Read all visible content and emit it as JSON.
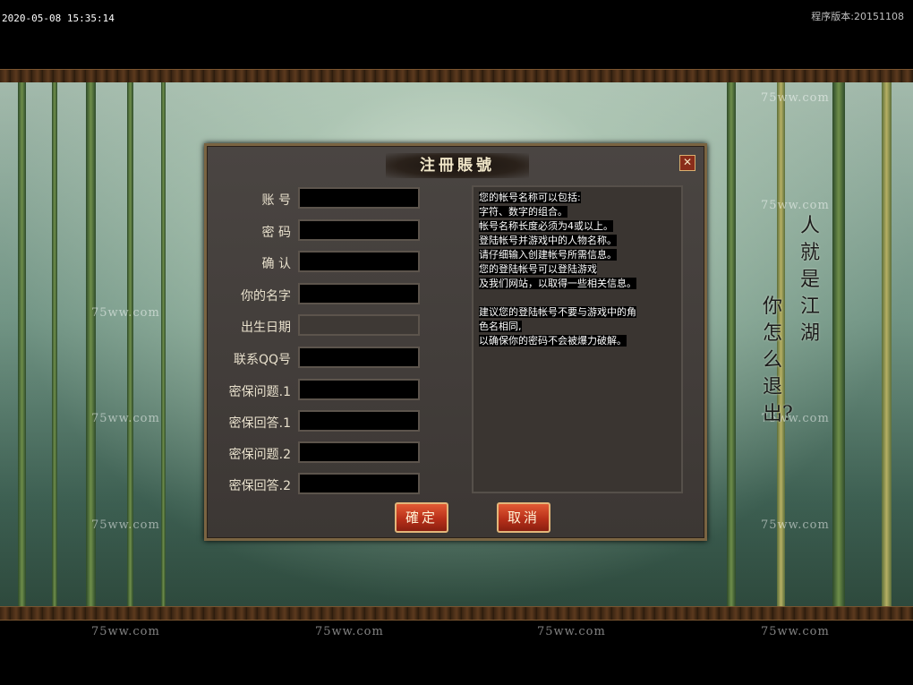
{
  "header": {
    "timestamp": "2020-05-08 15:35:14",
    "version": "程序版本:20151108"
  },
  "watermark": "75ww.com",
  "calligraphy": {
    "line1": "人就是江湖",
    "line2": "你怎么退出?"
  },
  "dialog": {
    "title": "注冊賬號",
    "close_label": "✕",
    "fields": [
      {
        "label": "账 号",
        "value": ""
      },
      {
        "label": "密 码",
        "value": ""
      },
      {
        "label": "确 认",
        "value": ""
      },
      {
        "label": "你的名字",
        "value": ""
      },
      {
        "label": "出生日期",
        "value": ""
      },
      {
        "label": "联系QQ号",
        "value": ""
      },
      {
        "label": "密保问题.1",
        "value": ""
      },
      {
        "label": "密保回答.1",
        "value": ""
      },
      {
        "label": "密保问题.2",
        "value": ""
      },
      {
        "label": "密保回答.2",
        "value": ""
      }
    ],
    "info_lines": [
      "您的帐号名称可以包括:",
      "字符、数字的组合。",
      "帐号名称长度必须为4或以上。",
      "登陆帐号并游戏中的人物名称。",
      "请仔细输入创建帐号所需信息。",
      "您的登陆帐号可以登陆游戏",
      "及我们网站，以取得一些相关信息。",
      "",
      "建议您的登陆帐号不要与游戏中的角",
      "色名相同,",
      "以确保你的密码不会被爆力破解。"
    ],
    "confirm_label": "確定",
    "cancel_label": "取消"
  }
}
